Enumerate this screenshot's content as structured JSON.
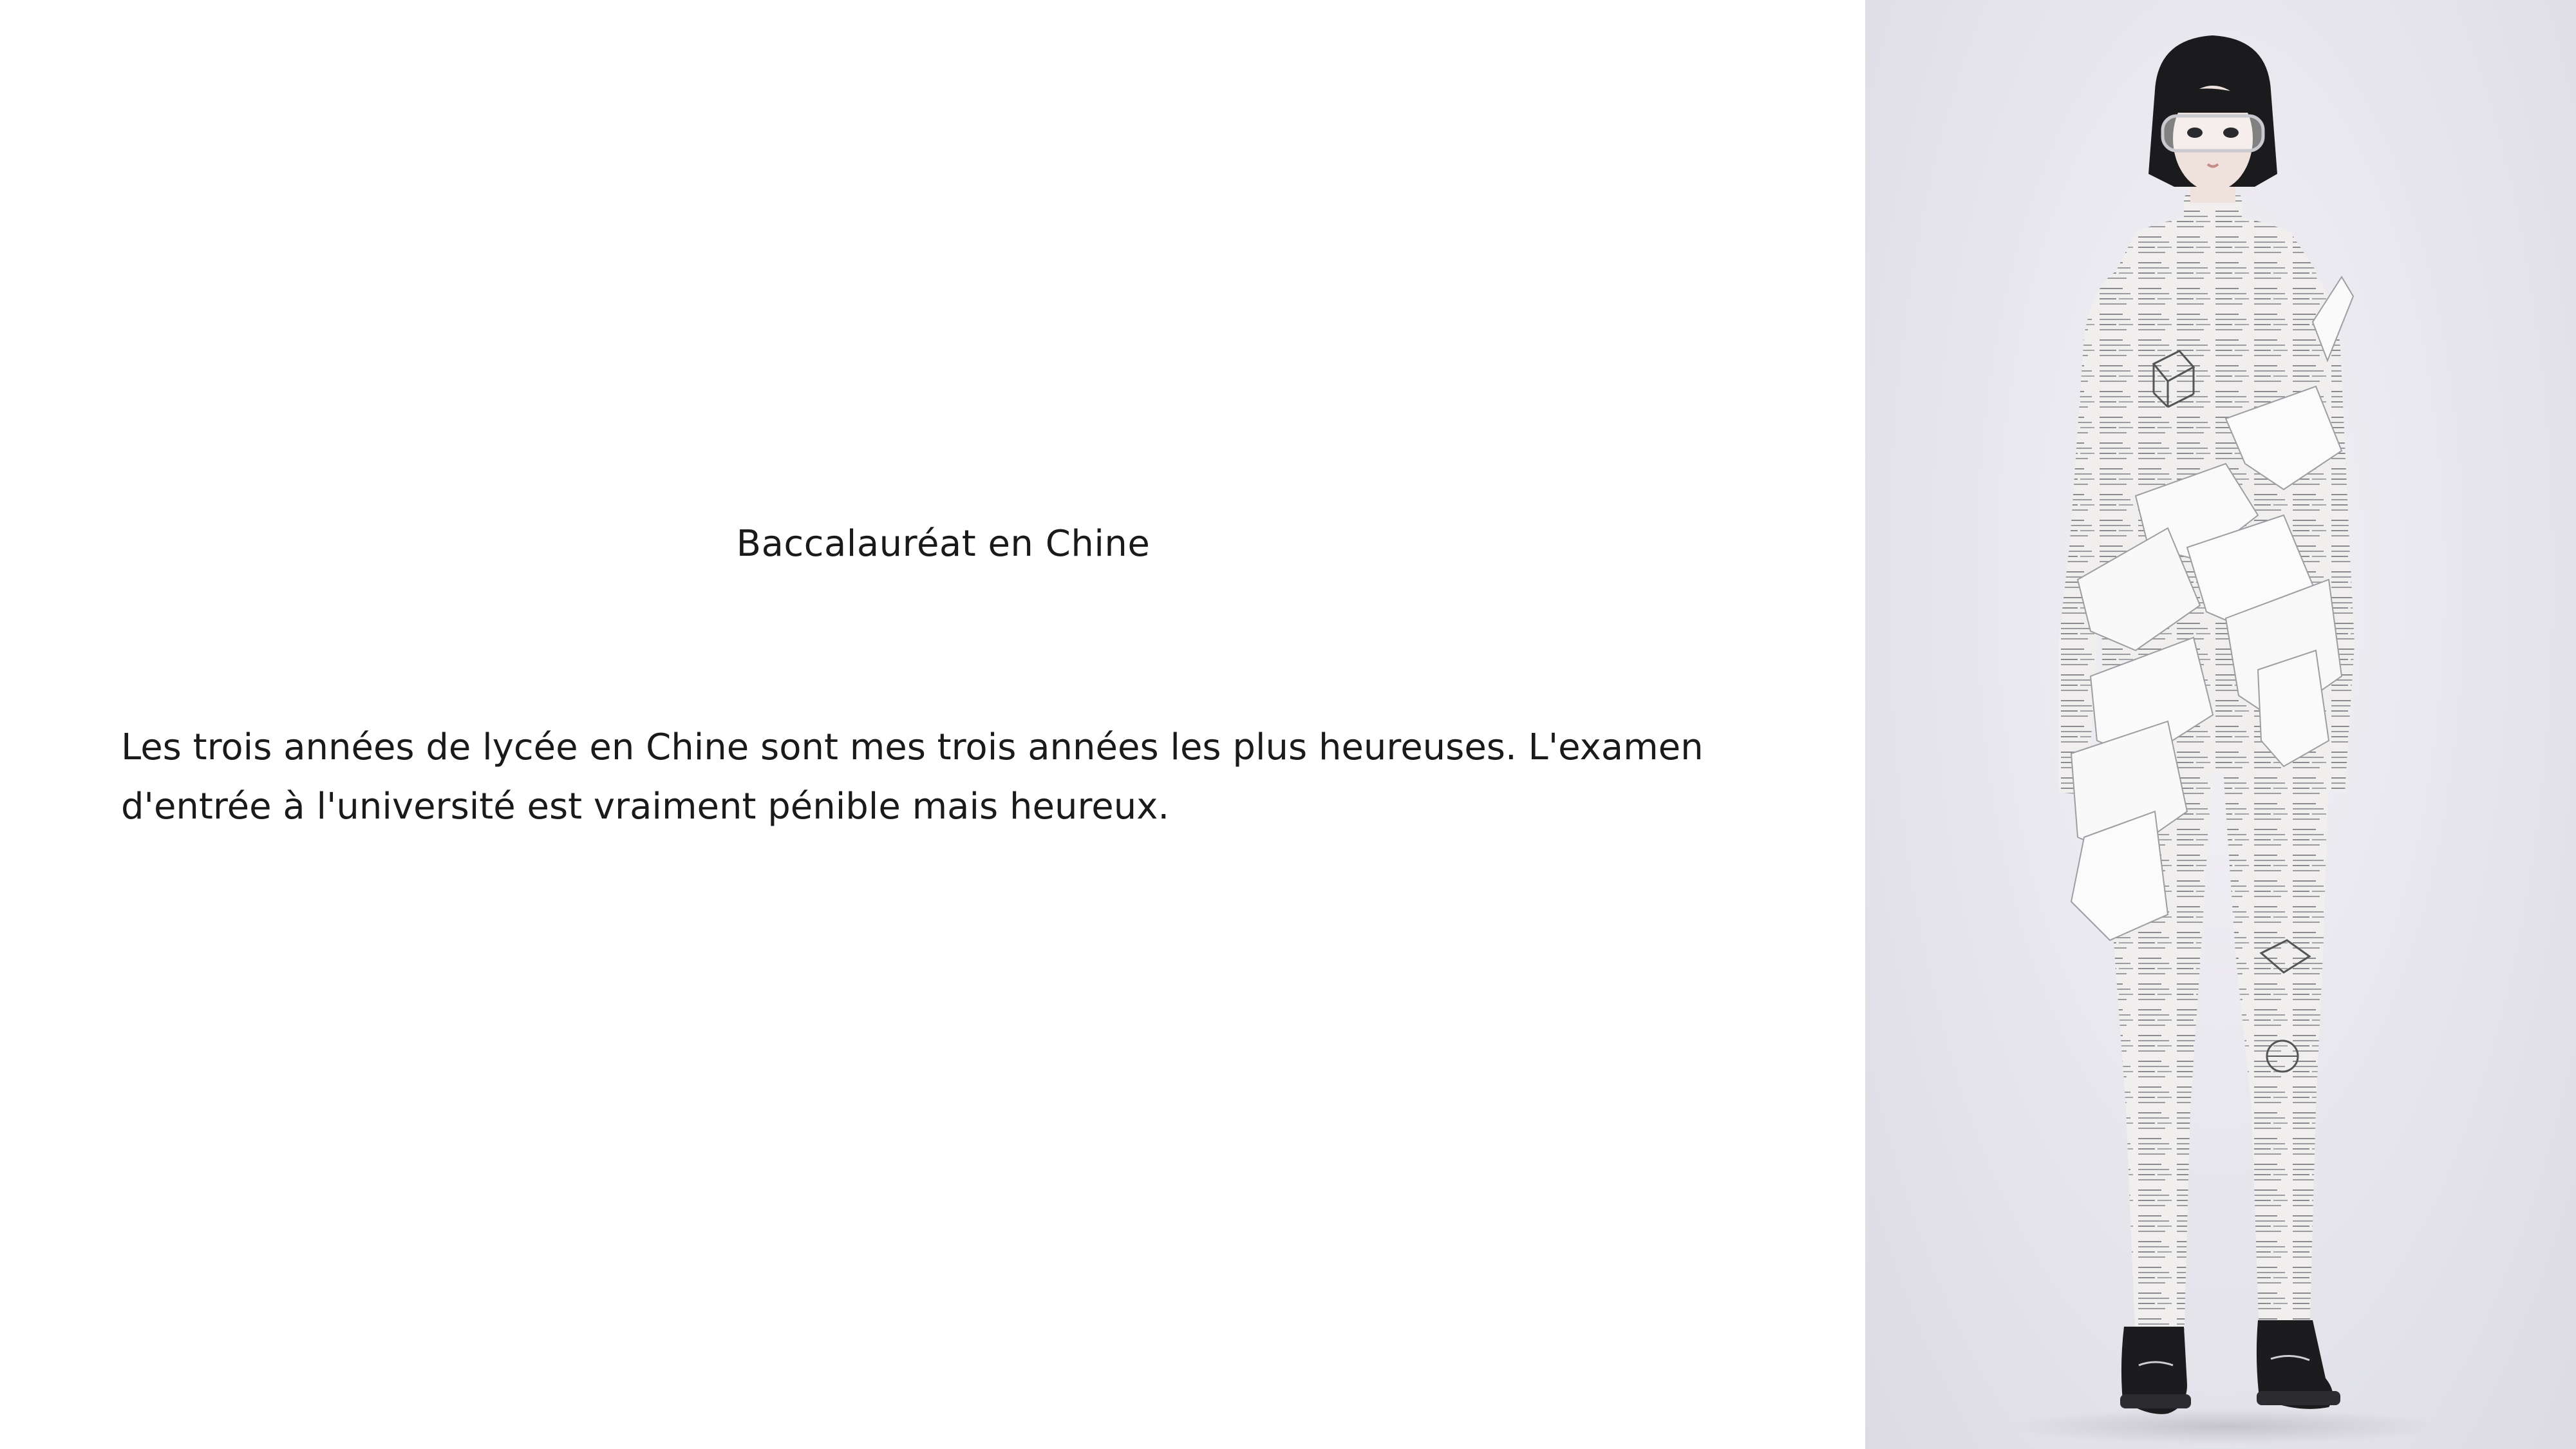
{
  "slide": {
    "title": "Baccalauréat en Chine",
    "body": "Les trois années de lycée en Chine sont mes trois années les plus heureuses. L'examen d'entrée à l'université est vraiment pénible mais heureux."
  },
  "photo": {
    "subject": "fashion-model",
    "colors": {
      "background": "#e6e5ec",
      "garment": "#f1eeee",
      "skin": "#efe1dc",
      "hair": "#1b1b1d",
      "shoes": "#1c1c1e"
    }
  }
}
